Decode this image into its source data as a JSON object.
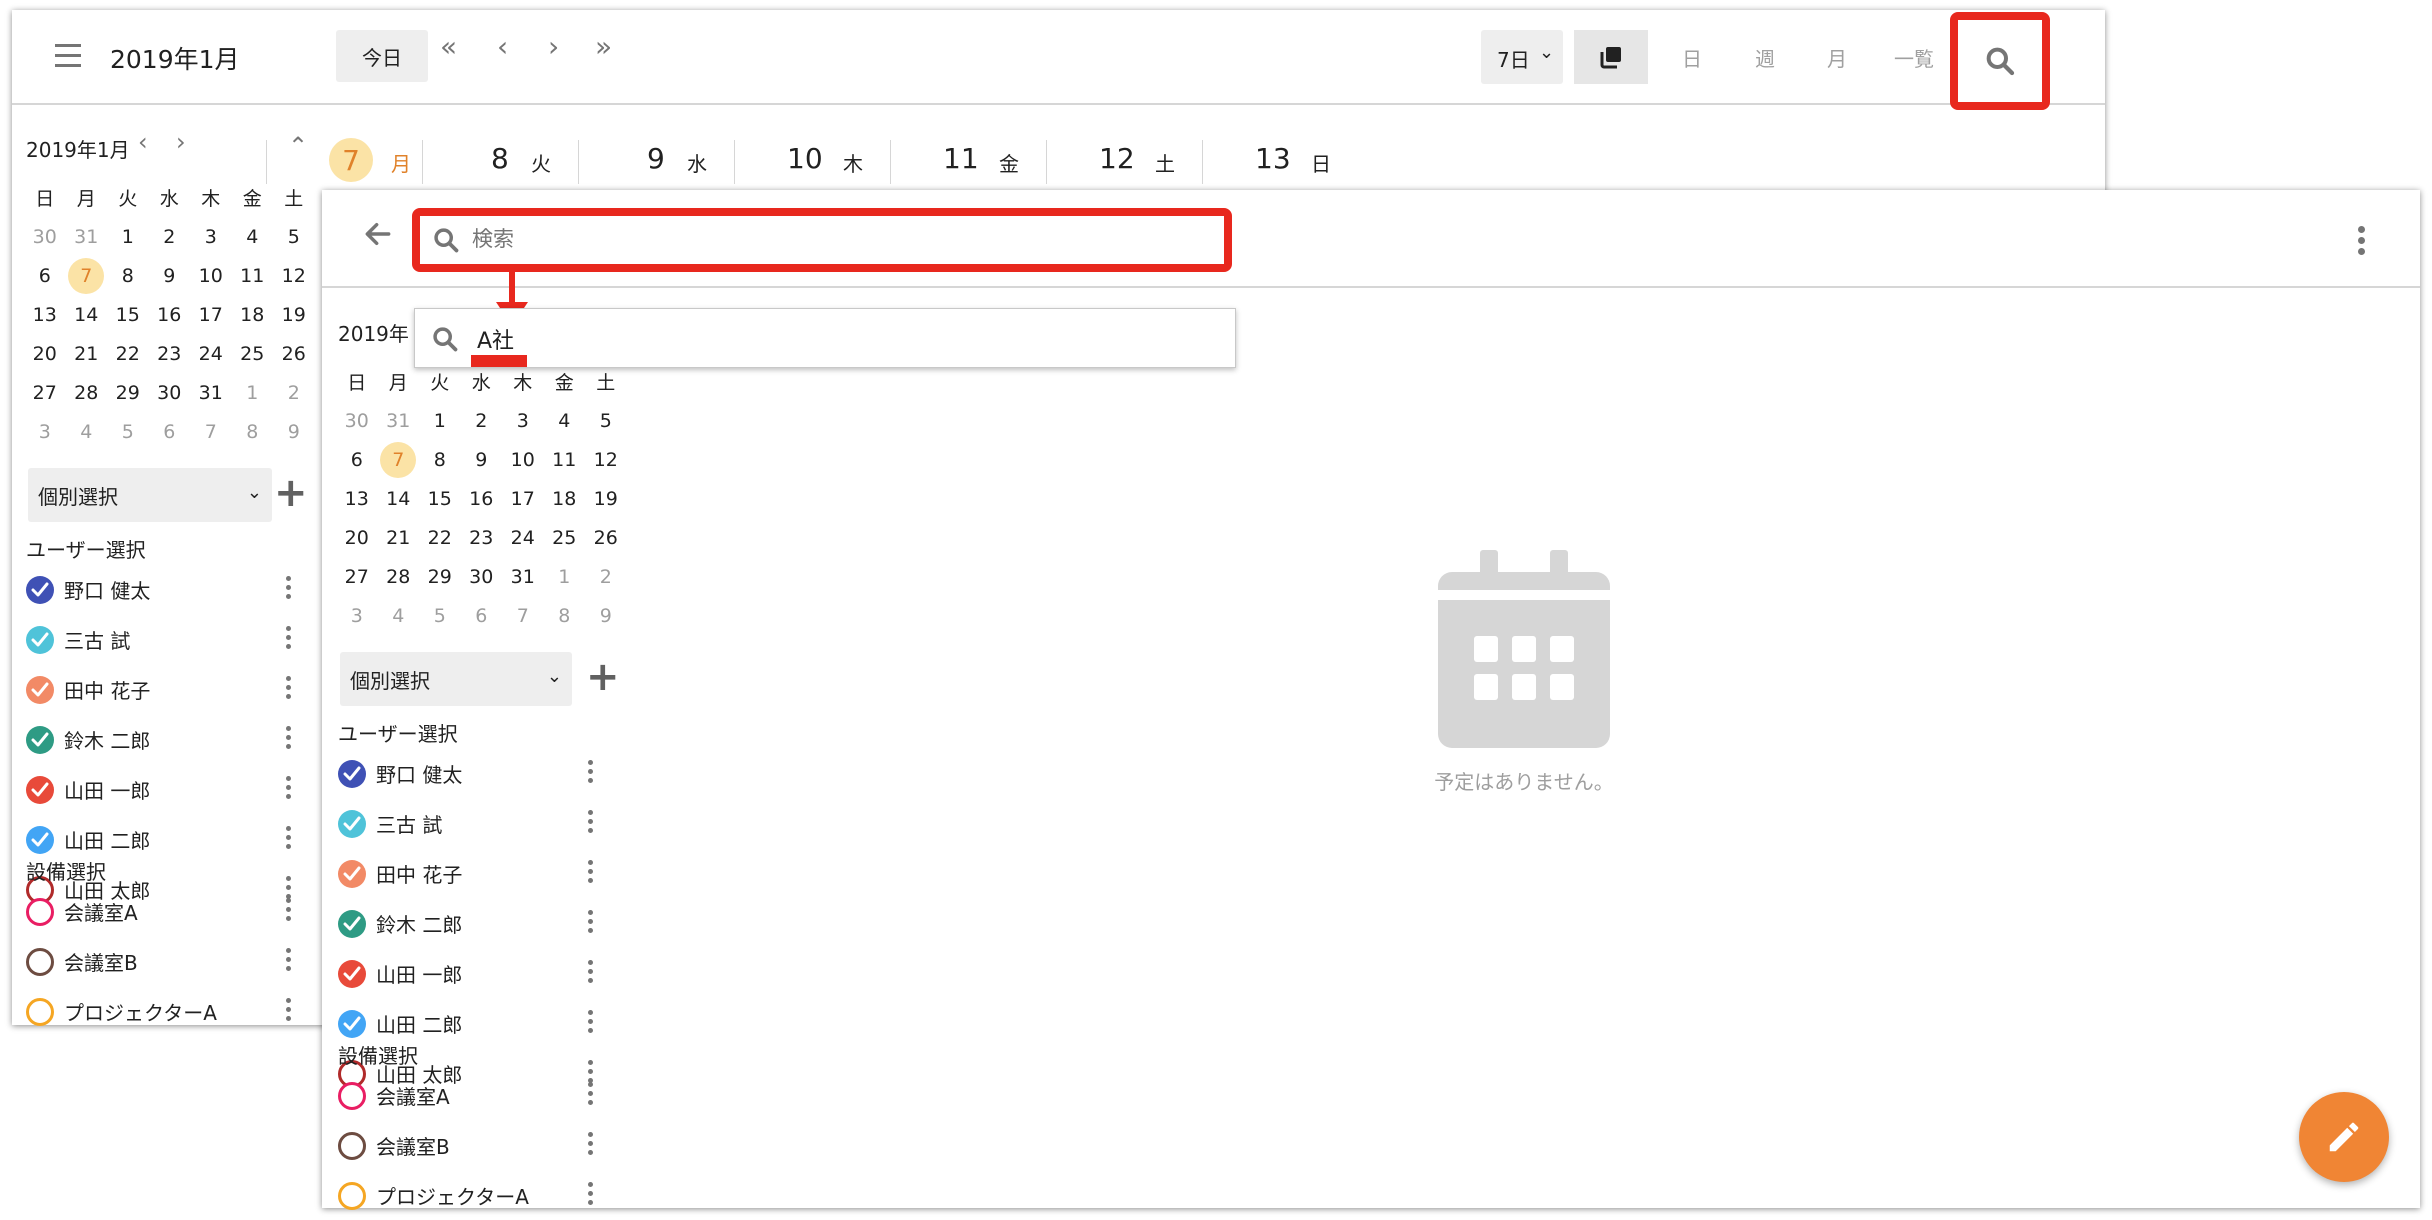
{
  "colors": {
    "accent_red": "#e8281e",
    "today_bg": "#fbe3a6",
    "today_fg": "#e0822a",
    "fab": "#f08534",
    "muted": "#9e9e9e"
  },
  "back_window": {
    "title": "2019年1月",
    "today_label": "今日",
    "range_select": "7日",
    "views": [
      "日",
      "週",
      "月",
      "一覧"
    ],
    "days": [
      {
        "num": "7",
        "dow": "月",
        "today": true
      },
      {
        "num": "8",
        "dow": "火"
      },
      {
        "num": "9",
        "dow": "水"
      },
      {
        "num": "10",
        "dow": "木"
      },
      {
        "num": "11",
        "dow": "金"
      },
      {
        "num": "12",
        "dow": "土"
      },
      {
        "num": "13",
        "dow": "日"
      }
    ]
  },
  "mini_calendar": {
    "title": "2019年1月",
    "weekdays": [
      "日",
      "月",
      "火",
      "水",
      "木",
      "金",
      "土"
    ],
    "weeks": [
      [
        "30",
        "31",
        "1",
        "2",
        "3",
        "4",
        "5"
      ],
      [
        "6",
        "7",
        "8",
        "9",
        "10",
        "11",
        "12"
      ],
      [
        "13",
        "14",
        "15",
        "16",
        "17",
        "18",
        "19"
      ],
      [
        "20",
        "21",
        "22",
        "23",
        "24",
        "25",
        "26"
      ],
      [
        "27",
        "28",
        "29",
        "30",
        "31",
        "1",
        "2"
      ],
      [
        "3",
        "4",
        "5",
        "6",
        "7",
        "8",
        "9"
      ]
    ],
    "today": "7"
  },
  "sidebar": {
    "select_label": "個別選択",
    "user_section": "ユーザー選択",
    "users": [
      {
        "name": "野口 健太",
        "color": "#3f51b5",
        "checked": true
      },
      {
        "name": "三古 試",
        "color": "#4fc3d9",
        "checked": true
      },
      {
        "name": "田中 花子",
        "color": "#f28a66",
        "checked": true
      },
      {
        "name": "鈴木 二郎",
        "color": "#2e9b84",
        "checked": true
      },
      {
        "name": "山田 一郎",
        "color": "#e84a3a",
        "checked": true
      },
      {
        "name": "山田 二郎",
        "color": "#42a5f5",
        "checked": true
      },
      {
        "name": "山田 太郎",
        "color": "#b02a2a",
        "checked": false
      }
    ],
    "facility_section": "設備選択",
    "facilities": [
      {
        "name": "会議室A",
        "color": "#e91e63",
        "checked": false
      },
      {
        "name": "会議室B",
        "color": "#6d4c41",
        "checked": false
      },
      {
        "name": "プロジェクターA",
        "color": "#f5a623",
        "checked": false
      }
    ]
  },
  "search": {
    "placeholder": "検索",
    "example_query": "A社",
    "empty_message": "予定はありません。"
  }
}
